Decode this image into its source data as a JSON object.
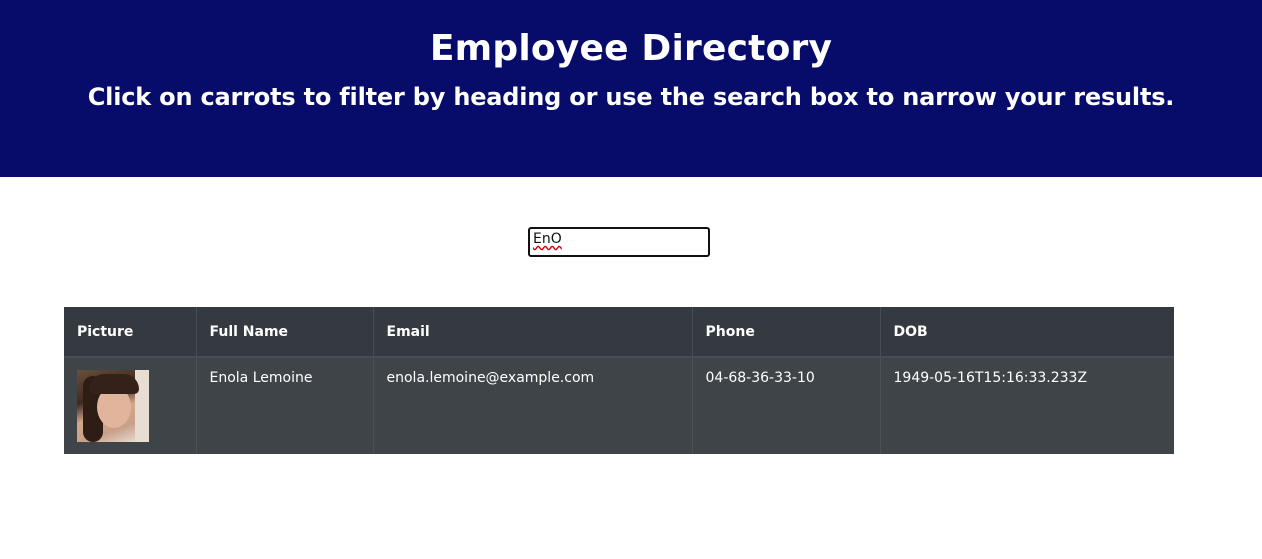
{
  "header": {
    "title": "Employee Directory",
    "subtitle": "Click on carrots to filter by heading or use the search box to narrow your results."
  },
  "search": {
    "value": "EnO",
    "placeholder": ""
  },
  "table": {
    "columns": [
      "Picture",
      "Full Name",
      "Email",
      "Phone",
      "DOB"
    ],
    "rows": [
      {
        "picture": "employee-photo",
        "full_name": "Enola Lemoine",
        "email": "enola.lemoine@example.com",
        "phone": "04-68-36-33-10",
        "dob": "1949-05-16T15:16:33.233Z"
      }
    ]
  },
  "colors": {
    "banner": "#070b69",
    "table_header": "#343a40",
    "table_row": "#3f4449"
  }
}
